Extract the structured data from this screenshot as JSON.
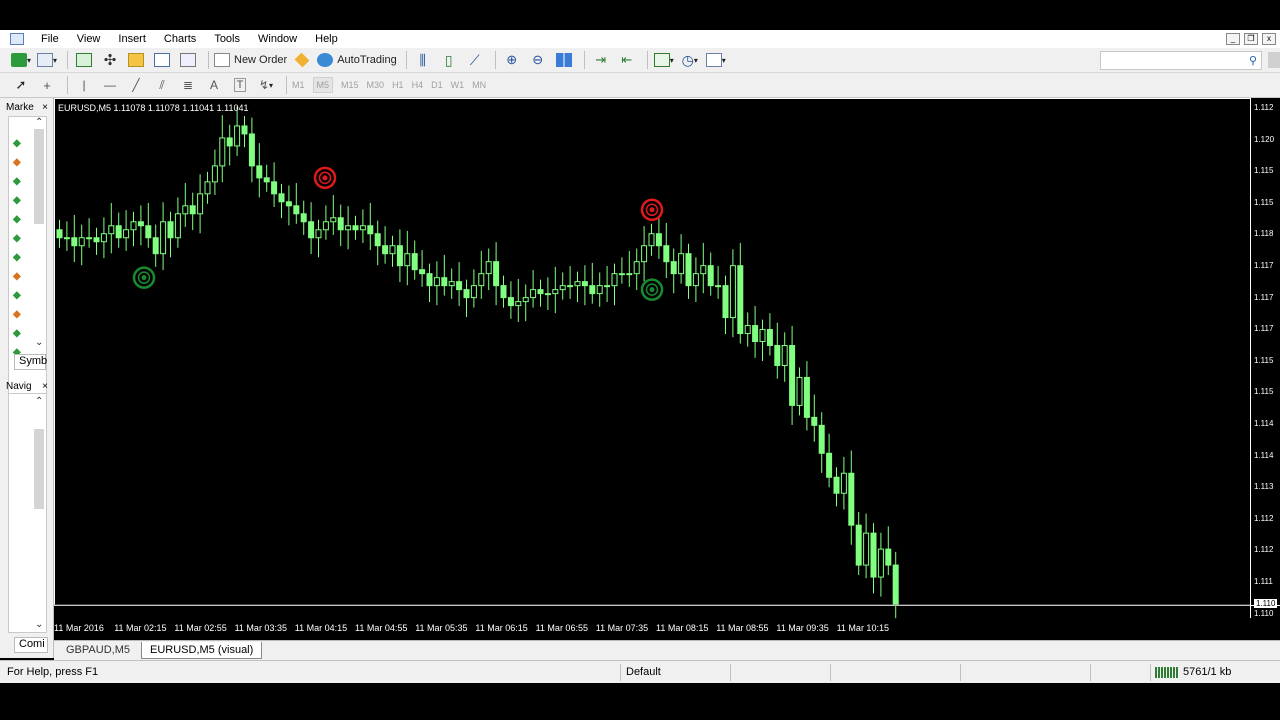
{
  "menu": [
    "File",
    "View",
    "Insert",
    "Charts",
    "Tools",
    "Window",
    "Help"
  ],
  "toolbar": {
    "new_order": "New Order",
    "autotrading": "AutoTrading",
    "timeframes": [
      "M1",
      "M5",
      "M15",
      "M30",
      "H1",
      "H4",
      "D1",
      "W1",
      "MN"
    ]
  },
  "sidebar": {
    "market_watch_title": "Marke",
    "symbols_tab": "Symb",
    "navigator_title": "Navig",
    "common_tab": "Comi",
    "close_glyph": "×",
    "rows": [
      "up",
      "down",
      "up",
      "up",
      "up",
      "up",
      "up",
      "down",
      "up",
      "down",
      "up",
      "up"
    ]
  },
  "chart": {
    "header": "EURUSD,M5  1.11078 1.11078 1.11041 1.11041",
    "time_labels": [
      "11 Mar 2016",
      "11 Mar 02:15",
      "11 Mar 02:55",
      "11 Mar 03:35",
      "11 Mar 04:15",
      "11 Mar 04:55",
      "11 Mar 05:35",
      "11 Mar 06:15",
      "11 Mar 06:55",
      "11 Mar 07:35",
      "11 Mar 08:15",
      "11 Mar 08:55",
      "11 Mar 09:35",
      "11 Mar 10:15"
    ],
    "price_labels": [
      "1.112",
      "1.120",
      "1.115",
      "1.115",
      "1.118",
      "1.117",
      "1.117",
      "1.117",
      "1.115",
      "1.115",
      "1.114",
      "1.114",
      "1.113",
      "1.112",
      "1.112",
      "1.111",
      "1.110",
      "1.110"
    ],
    "current_price_label": "1.110",
    "candle_color": "#80ff80",
    "buy_marker_color": "#1a8a2e",
    "sell_marker_color": "#e01a1a"
  },
  "chart_data": {
    "type": "candlestick",
    "title": "EURUSD,M5",
    "ohlc_header": [
      1.11078,
      1.11078,
      1.11041,
      1.11041
    ],
    "closes": [
      1.1172,
      1.1172,
      1.117,
      1.1172,
      1.1172,
      1.1171,
      1.1173,
      1.1175,
      1.1172,
      1.1174,
      1.1176,
      1.1175,
      1.1172,
      1.1168,
      1.1176,
      1.1172,
      1.1178,
      1.118,
      1.1178,
      1.1183,
      1.1186,
      1.119,
      1.1197,
      1.1195,
      1.12,
      1.1198,
      1.119,
      1.1187,
      1.1186,
      1.1183,
      1.1181,
      1.118,
      1.1178,
      1.1176,
      1.1172,
      1.1174,
      1.1176,
      1.1177,
      1.1174,
      1.1175,
      1.1174,
      1.1175,
      1.1173,
      1.117,
      1.1168,
      1.117,
      1.1165,
      1.1168,
      1.1164,
      1.1163,
      1.116,
      1.1162,
      1.116,
      1.1161,
      1.1159,
      1.1157,
      1.116,
      1.1163,
      1.1166,
      1.116,
      1.1157,
      1.1155,
      1.1156,
      1.1157,
      1.1159,
      1.1158,
      1.1158,
      1.1159,
      1.116,
      1.116,
      1.1161,
      1.116,
      1.1158,
      1.116,
      1.116,
      1.1163,
      1.1163,
      1.1163,
      1.1166,
      1.117,
      1.1173,
      1.117,
      1.1166,
      1.1163,
      1.1168,
      1.116,
      1.1163,
      1.1165,
      1.116,
      1.116,
      1.1152,
      1.1165,
      1.1148,
      1.115,
      1.1146,
      1.1149,
      1.1145,
      1.114,
      1.1145,
      1.113,
      1.1137,
      1.1127,
      1.1125,
      1.1118,
      1.1112,
      1.1108,
      1.1113,
      1.11,
      1.109,
      1.1098,
      1.1087,
      1.1094,
      1.109,
      1.108
    ],
    "signals": [
      {
        "type": "buy",
        "time": "11 Mar 02:05",
        "price": 1.1162
      },
      {
        "type": "sell",
        "time": "11 Mar 04:15",
        "price": 1.1187
      },
      {
        "type": "sell",
        "time": "11 Mar 07:45",
        "price": 1.1179
      },
      {
        "type": "buy",
        "time": "11 Mar 07:45",
        "price": 1.1159
      }
    ]
  },
  "tabs": [
    "GBPAUD,M5",
    "EURUSD,M5 (visual)"
  ],
  "status": {
    "help": "For Help, press F1",
    "profile": "Default",
    "traffic": "5761/1 kb"
  }
}
